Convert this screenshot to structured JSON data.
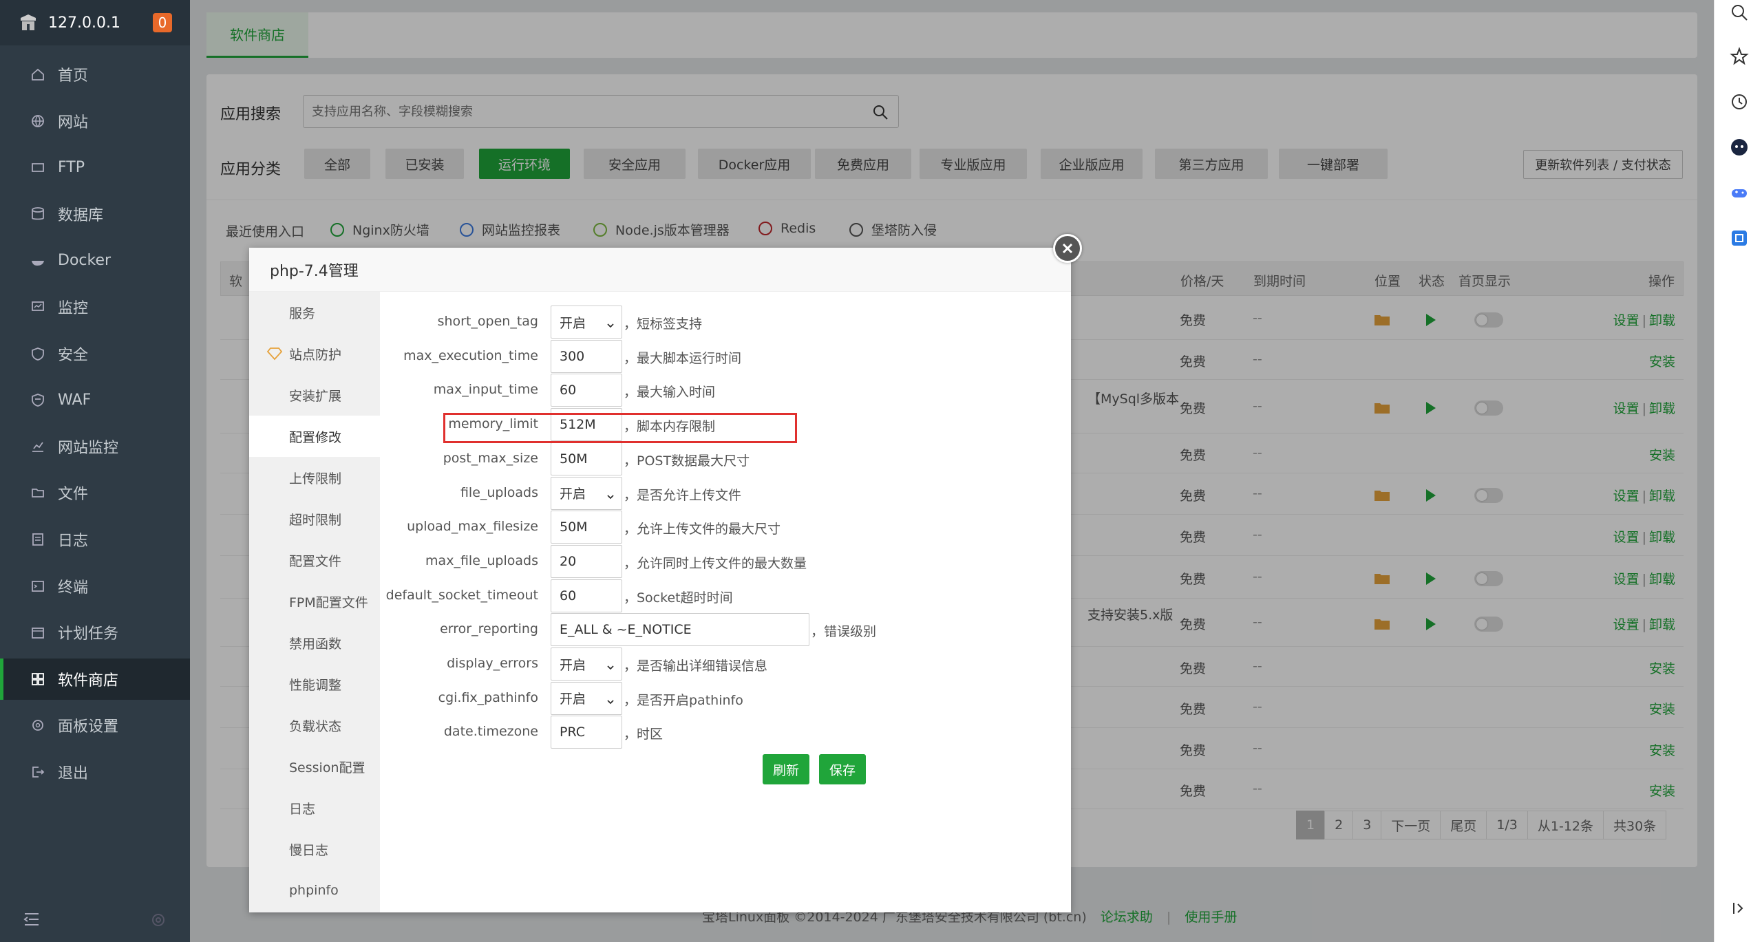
{
  "sidebar": {
    "ip": "127.0.0.1",
    "badge": "0",
    "items": [
      {
        "label": "首页",
        "icon": "home-icon"
      },
      {
        "label": "网站",
        "icon": "globe-icon"
      },
      {
        "label": "FTP",
        "icon": "ftp-icon"
      },
      {
        "label": "数据库",
        "icon": "database-icon"
      },
      {
        "label": "Docker",
        "icon": "docker-icon"
      },
      {
        "label": "监控",
        "icon": "monitor-icon"
      },
      {
        "label": "安全",
        "icon": "shield-icon"
      },
      {
        "label": "WAF",
        "icon": "waf-icon"
      },
      {
        "label": "网站监控",
        "icon": "chart-icon"
      },
      {
        "label": "文件",
        "icon": "folder-icon"
      },
      {
        "label": "日志",
        "icon": "log-icon"
      },
      {
        "label": "终端",
        "icon": "terminal-icon"
      },
      {
        "label": "计划任务",
        "icon": "calendar-icon"
      },
      {
        "label": "软件商店",
        "icon": "apps-icon",
        "active": true
      },
      {
        "label": "面板设置",
        "icon": "gear-icon"
      },
      {
        "label": "退出",
        "icon": "logout-icon"
      }
    ]
  },
  "top_tab": "软件商店",
  "search": {
    "label": "应用搜索",
    "placeholder": "支持应用名称、字段模糊搜索"
  },
  "categories": {
    "label": "应用分类",
    "items": [
      "全部",
      "已安装",
      "运行环境",
      "安全应用",
      "Docker应用",
      "免费应用",
      "专业版应用",
      "企业版应用",
      "第三方应用",
      "一键部署"
    ],
    "active": "运行环境",
    "update_button": "更新软件列表 / 支付状态"
  },
  "recent": {
    "label": "最近使用入口",
    "items": [
      "Nginx防火墙",
      "网站监控报表",
      "Node.js版本管理器",
      "Redis",
      "堡塔防入侵"
    ]
  },
  "table": {
    "headers": {
      "name": "软",
      "price": "价格/天",
      "expire": "到期时间",
      "location": "位置",
      "status": "状态",
      "home": "首页显示",
      "ops": "操作"
    },
    "free": "免费",
    "dash": "--",
    "set": "设置",
    "uninstall": "卸载",
    "install": "安装",
    "extra_mysql": "【MySql多版本",
    "extra_redis": "支持安装5.x版"
  },
  "pager": [
    "1",
    "2",
    "3",
    "下一页",
    "尾页",
    "1/3",
    "从1-12条",
    "共30条"
  ],
  "footer": {
    "copyright": "宝塔Linux面板 ©2014-2024 广东堡塔安全技术有限公司 (bt.cn)",
    "forum": "论坛求助",
    "manual": "使用手册"
  },
  "modal": {
    "title": "php-7.4管理",
    "nav": [
      "服务",
      "站点防护",
      "安装扩展",
      "配置修改",
      "上传限制",
      "超时限制",
      "配置文件",
      "FPM配置文件",
      "禁用函数",
      "性能调整",
      "负载状态",
      "Session配置",
      "日志",
      "慢日志",
      "phpinfo"
    ],
    "active_nav": "配置修改",
    "fields": [
      {
        "name": "short_open_tag",
        "value": "开启",
        "type": "select",
        "desc": "，短标签支持"
      },
      {
        "name": "max_execution_time",
        "value": "300",
        "type": "input",
        "desc": "，最大脚本运行时间"
      },
      {
        "name": "max_input_time",
        "value": "60",
        "type": "input",
        "desc": "，最大输入时间"
      },
      {
        "name": "memory_limit",
        "value": "512M",
        "type": "input",
        "desc": "，脚本内存限制"
      },
      {
        "name": "post_max_size",
        "value": "50M",
        "type": "input",
        "desc": "，POST数据最大尺寸"
      },
      {
        "name": "file_uploads",
        "value": "开启",
        "type": "select",
        "desc": "，是否允许上传文件"
      },
      {
        "name": "upload_max_filesize",
        "value": "50M",
        "type": "input",
        "desc": "，允许上传文件的最大尺寸"
      },
      {
        "name": "max_file_uploads",
        "value": "20",
        "type": "input",
        "desc": "，允许同时上传文件的最大数量"
      },
      {
        "name": "default_socket_timeout",
        "value": "60",
        "type": "input",
        "desc": "，Socket超时时间"
      },
      {
        "name": "error_reporting",
        "value": "E_ALL & ~E_NOTICE",
        "type": "wide",
        "desc": "，错误级别"
      },
      {
        "name": "display_errors",
        "value": "开启",
        "type": "select",
        "desc": "，是否输出详细错误信息"
      },
      {
        "name": "cgi.fix_pathinfo",
        "value": "开启",
        "type": "select",
        "desc": "，是否开启pathinfo"
      },
      {
        "name": "date.timezone",
        "value": "PRC",
        "type": "input",
        "desc": "，时区"
      }
    ],
    "refresh_label": "刷新",
    "save_label": "保存"
  },
  "colors": {
    "accent": "#20a53a",
    "sidebar": "#2f3b45",
    "highlight": "#e0302e"
  }
}
